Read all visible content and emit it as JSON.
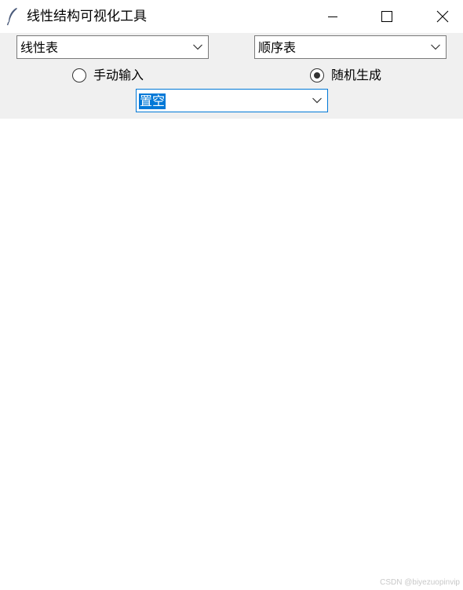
{
  "window": {
    "title": "线性结构可视化工具"
  },
  "controls": {
    "structure_type": {
      "selected": "线性表"
    },
    "storage_type": {
      "selected": "顺序表"
    },
    "input_mode": {
      "options": [
        {
          "label": "手动输入",
          "checked": false
        },
        {
          "label": "随机生成",
          "checked": true
        }
      ]
    },
    "operation": {
      "selected": "置空"
    }
  },
  "watermark": "CSDN @biyezuopinvip",
  "icons": {
    "app": "feather-icon",
    "minimize": "minimize-icon",
    "maximize": "maximize-icon",
    "close": "close-icon",
    "dropdown": "chevron-down-icon"
  },
  "colors": {
    "toolbar_bg": "#f0f0f0",
    "focus_accent": "#0078d7",
    "canvas_bg": "#ffffff"
  }
}
